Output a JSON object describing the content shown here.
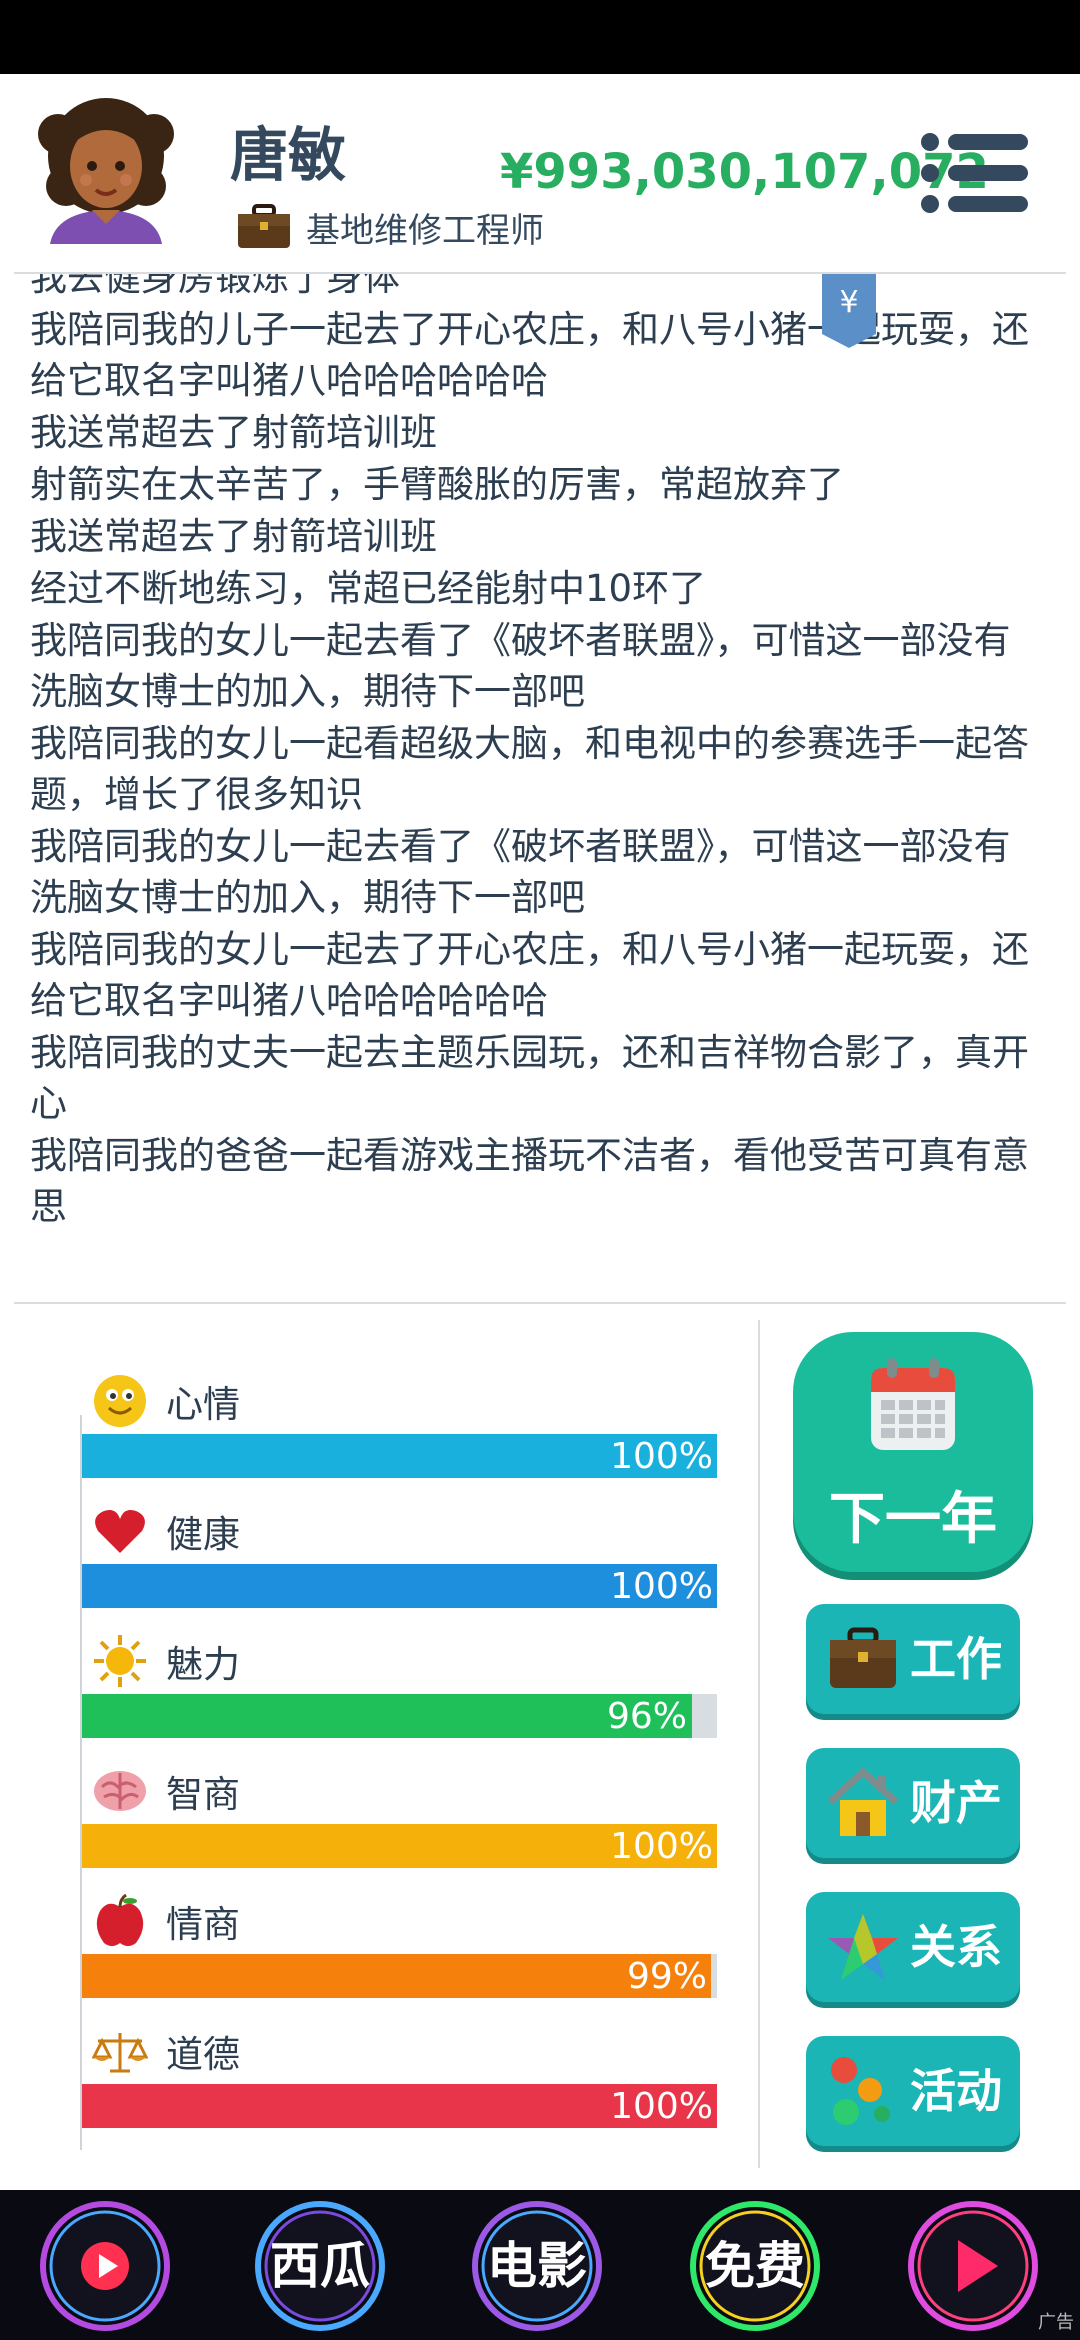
{
  "player": {
    "name": "唐敏",
    "job": "基地维修工程师",
    "money": "¥993,030,107,072"
  },
  "events": [
    "我去健身房锻炼了身体",
    "我陪同我的儿子一起去了开心农庄，和八号小猪一起玩耍，还给它取名字叫猪八哈哈哈哈哈哈",
    "我送常超去了射箭培训班",
    "射箭实在太辛苦了，手臂酸胀的厉害，常超放弃了",
    "我送常超去了射箭培训班",
    "经过不断地练习，常超已经能射中10环了",
    "我陪同我的女儿一起去看了《破坏者联盟》，可惜这一部没有洗脑女博士的加入，期待下一部吧",
    "我陪同我的女儿一起看超级大脑，和电视中的参赛选手一起答题，增长了很多知识",
    "我陪同我的女儿一起去看了《破坏者联盟》，可惜这一部没有洗脑女博士的加入，期待下一部吧",
    "我陪同我的女儿一起去了开心农庄，和八号小猪一起玩耍，还给它取名字叫猪八哈哈哈哈哈哈",
    "我陪同我的丈夫一起去主题乐园玩，还和吉祥物合影了，真开心",
    "我陪同我的爸爸一起看游戏主播玩不洁者，看他受苦可真有意思"
  ],
  "yuan_tag": "¥",
  "stats": [
    {
      "label": "心情",
      "value": 100,
      "pct": "100%",
      "color": "#1ab0de",
      "icon": "smiley-icon"
    },
    {
      "label": "健康",
      "value": 100,
      "pct": "100%",
      "color": "#1e8fdc",
      "icon": "heart-icon"
    },
    {
      "label": "魅力",
      "value": 96,
      "pct": "96%",
      "color": "#1fbf5a",
      "icon": "sun-icon"
    },
    {
      "label": "智商",
      "value": 100,
      "pct": "100%",
      "color": "#f5b10a",
      "icon": "brain-icon"
    },
    {
      "label": "情商",
      "value": 99,
      "pct": "99%",
      "color": "#f5800c",
      "icon": "apple-icon"
    },
    {
      "label": "道德",
      "value": 100,
      "pct": "100%",
      "color": "#e8354a",
      "icon": "scales-icon"
    }
  ],
  "actions": {
    "next_year": "下一年",
    "work": "工作",
    "property": "财产",
    "relations": "关系",
    "activity": "活动"
  },
  "ads": {
    "b1": "",
    "b2": "西瓜",
    "b3": "电影",
    "b4": "免费",
    "b5": "",
    "ad_label": "广告"
  }
}
